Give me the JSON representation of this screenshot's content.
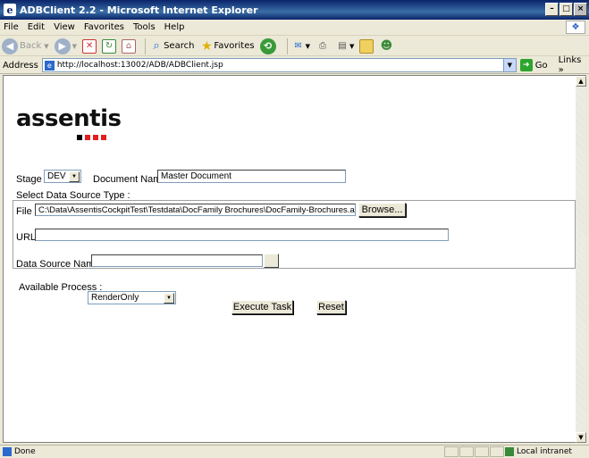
{
  "window": {
    "title": "ADBClient 2.2 - Microsoft Internet Explorer"
  },
  "menu": {
    "items": [
      "File",
      "Edit",
      "View",
      "Favorites",
      "Tools",
      "Help"
    ]
  },
  "toolbar": {
    "back": "Back",
    "search": "Search",
    "favorites": "Favorites"
  },
  "addressbar": {
    "label": "Address",
    "url": "http://localhost:13002/ADB/ADBClient.jsp",
    "go": "Go",
    "links": "Links"
  },
  "logo": {
    "text": "assentis",
    "dot_colors": [
      "#000000",
      "#e02020",
      "#e02020",
      "#e02020"
    ]
  },
  "form": {
    "stage_label": "Stage :",
    "stage_value": "DEV",
    "docname_label": "Document Name :",
    "docname_value": "Master Document",
    "source_type_label": "Select Data Source Type :",
    "file_label": "File :",
    "file_value": "C:\\Data\\AssentisCockpitTest\\Testdata\\DocFamily Brochures\\DocFamily-Brochures.acr",
    "browse_label": "Browse...",
    "url_label": "URL:",
    "url_value": "",
    "dsname_label": "Data Source Name :",
    "dsname_value": "",
    "process_label": "Available Process :",
    "process_value": "RenderOnly",
    "execute_label": "Execute Task",
    "reset_label": "Reset"
  },
  "status": {
    "text": "Done",
    "zone": "Local intranet"
  }
}
